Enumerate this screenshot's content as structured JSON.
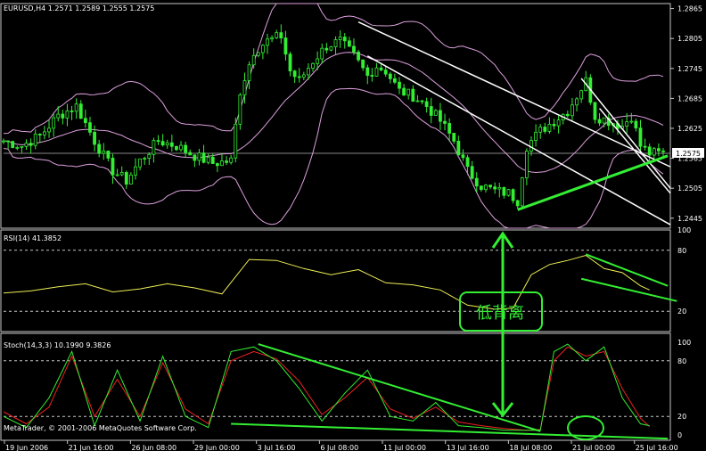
{
  "header": {
    "main_label": "EURUSD,H4  1.2571 1.2589 1.2555 1.2575",
    "rsi_label": "RSI(14) 41.3852",
    "stoch_label": "Stoch(14,3,3) 10.1990 9.3826",
    "copyright": "MetaTrader, © 2001-2006 MetaQuotes Software Corp.",
    "annotation": "低背离"
  },
  "colors": {
    "background": "#000000",
    "bull_candle": "#33ee33",
    "bear_candle": "#33ee33",
    "bands": "#dda0dd",
    "trendline": "#ffffff",
    "green_line": "#33ee33",
    "rsi_line": "#eeee55",
    "stoch_main": "#33ee33",
    "stoch_signal": "#ee2222",
    "grid": "#c8c8c8",
    "price_tag_bg": "#ffffff",
    "price_tag_fg": "#000000"
  },
  "chart_data": [
    {
      "type": "candlestick",
      "panel": "price",
      "symbol": "EURUSD",
      "timeframe": "H4",
      "last": {
        "open": 1.2571,
        "high": 1.2589,
        "low": 1.2555,
        "close": 1.2575
      },
      "current_price": "1.2575",
      "ylim": [
        1.2425,
        1.2875
      ],
      "y_ticks": [
        "1.2865",
        "1.2805",
        "1.2745",
        "1.2685",
        "1.2625",
        "1.2565",
        "1.2505",
        "1.2445"
      ],
      "x_ticks": [
        "19 Jun 2006",
        "21 Jun 16:00",
        "26 Jun 08:00",
        "29 Jun 00:00",
        "3 Jul 16:00",
        "6 Jul 08:00",
        "11 Jul 00:00",
        "13 Jul 16:00",
        "18 Jul 08:00",
        "21 Jul 00:00",
        "25 Jul 16:00"
      ],
      "close_path": [
        [
          0,
          1.26
        ],
        [
          4,
          1.259
        ],
        [
          8,
          1.261
        ],
        [
          12,
          1.265
        ],
        [
          16,
          1.267
        ],
        [
          20,
          1.26
        ],
        [
          24,
          1.254
        ],
        [
          27,
          1.252
        ],
        [
          30,
          1.256
        ],
        [
          34,
          1.26
        ],
        [
          38,
          1.259
        ],
        [
          42,
          1.257
        ],
        [
          46,
          1.2555
        ],
        [
          50,
          1.256
        ],
        [
          52,
          1.27
        ],
        [
          55,
          1.278
        ],
        [
          58,
          1.28
        ],
        [
          61,
          1.281
        ],
        [
          63,
          1.274
        ],
        [
          65,
          1.272
        ],
        [
          68,
          1.276
        ],
        [
          71,
          1.279
        ],
        [
          74,
          1.28
        ],
        [
          77,
          1.277
        ],
        [
          80,
          1.273
        ],
        [
          82,
          1.275
        ],
        [
          84,
          1.274
        ],
        [
          87,
          1.27
        ],
        [
          90,
          1.269
        ],
        [
          93,
          1.267
        ],
        [
          96,
          1.264
        ],
        [
          99,
          1.26
        ],
        [
          102,
          1.254
        ],
        [
          105,
          1.251
        ],
        [
          108,
          1.25
        ],
        [
          111,
          1.2495
        ],
        [
          113,
          1.248
        ],
        [
          115,
          1.259
        ],
        [
          118,
          1.262
        ],
        [
          121,
          1.264
        ],
        [
          124,
          1.266
        ],
        [
          126,
          1.269
        ],
        [
          128,
          1.272
        ],
        [
          130,
          1.265
        ],
        [
          133,
          1.264
        ],
        [
          136,
          1.263
        ],
        [
          138,
          1.265
        ],
        [
          140,
          1.259
        ],
        [
          142,
          1.2575
        ]
      ],
      "bars_total": 146
    },
    {
      "type": "line",
      "panel": "rsi",
      "name": "RSI(14)",
      "last": 41.3852,
      "ylim": [
        0,
        100
      ],
      "levels": [
        80,
        20
      ],
      "y_ticks": [
        "100",
        "80",
        "20"
      ],
      "x": [
        0,
        6,
        12,
        18,
        24,
        30,
        36,
        42,
        48,
        54,
        60,
        66,
        72,
        78,
        84,
        90,
        96,
        102,
        108,
        112,
        116,
        120,
        124,
        128,
        132,
        136,
        140,
        142
      ],
      "values": [
        38,
        40,
        44,
        47,
        39,
        42,
        47,
        43,
        37,
        71,
        70,
        62,
        56,
        61,
        48,
        46,
        41,
        26,
        22,
        23,
        56,
        66,
        70,
        75,
        62,
        58,
        45,
        41
      ]
    },
    {
      "type": "line",
      "panel": "stochastic",
      "name": "Stoch(14,3,3)",
      "main_last": 10.199,
      "signal_last": 9.3826,
      "ylim": [
        0,
        100
      ],
      "levels": [
        80,
        20
      ],
      "y_ticks": [
        "100",
        "80",
        "20",
        "0"
      ],
      "x": [
        0,
        5,
        10,
        15,
        20,
        25,
        30,
        35,
        40,
        45,
        50,
        55,
        60,
        65,
        70,
        75,
        80,
        85,
        90,
        95,
        100,
        105,
        110,
        115,
        118,
        121,
        124,
        128,
        132,
        136,
        140,
        142
      ],
      "main": [
        20,
        8,
        40,
        90,
        10,
        70,
        15,
        85,
        20,
        8,
        90,
        95,
        80,
        50,
        15,
        45,
        70,
        20,
        15,
        35,
        10,
        8,
        5,
        5,
        5,
        90,
        98,
        80,
        95,
        40,
        12,
        10
      ],
      "signal": [
        25,
        12,
        30,
        85,
        20,
        60,
        20,
        78,
        28,
        12,
        80,
        90,
        82,
        58,
        22,
        40,
        62,
        28,
        18,
        30,
        14,
        10,
        7,
        5,
        6,
        80,
        95,
        85,
        90,
        50,
        18,
        9
      ]
    }
  ]
}
